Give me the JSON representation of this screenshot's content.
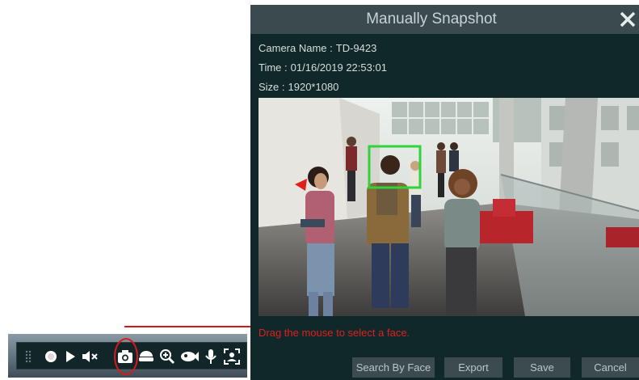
{
  "dialog": {
    "title": "Manually Snapshot",
    "camera_name_label": "Camera Name :",
    "camera_name": "TD-9423",
    "time_label": "Time :",
    "time": "01/16/2019 22:53:01",
    "size_label": "Size :",
    "size": "1920*1080",
    "hint": "Drag the mouse to select a face.",
    "buttons": {
      "search_by_face": "Search By Face",
      "export": "Export",
      "save": "Save",
      "cancel": "Cancel"
    }
  },
  "toolbar": {
    "icons": [
      "drag-handle-icon",
      "record-icon",
      "play-icon",
      "mute-icon",
      "snapshot-icon",
      "ptz-icon",
      "zoom-in-icon",
      "fisheye-icon",
      "microphone-icon",
      "face-detect-icon"
    ]
  },
  "colors": {
    "accent_red": "#e01f1f",
    "dialog_bg": "#10282a",
    "title_bar": "#3a4a4f",
    "face_box": "#2fd33b"
  }
}
